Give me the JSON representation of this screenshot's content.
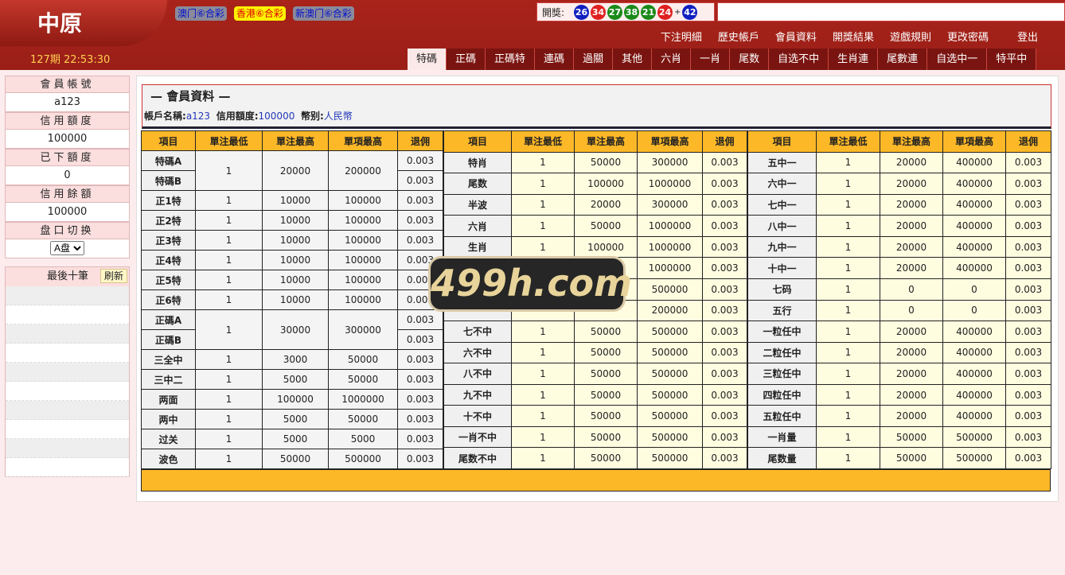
{
  "header": {
    "logo": "中原",
    "period": "127期 22:53:30",
    "lotteries": [
      {
        "label": "澳门⑥合彩",
        "active": false
      },
      {
        "label": "香港⑥合彩",
        "active": true
      },
      {
        "label": "新澳门⑥合彩",
        "active": false
      }
    ],
    "draw_label": "開獎:",
    "plus": "+",
    "balls": [
      {
        "n": "26",
        "color": "#1020c0"
      },
      {
        "n": "34",
        "color": "#e02020"
      },
      {
        "n": "27",
        "color": "#1a8a1a"
      },
      {
        "n": "38",
        "color": "#1a8a1a"
      },
      {
        "n": "21",
        "color": "#1a8a1a"
      },
      {
        "n": "24",
        "color": "#e02020"
      }
    ],
    "special": {
      "n": "42",
      "color": "#1020c0"
    },
    "nav": [
      "下注明細",
      "歷史帳戶",
      "會員資料",
      "開獎結果",
      "遊戲規則",
      "更改密碼",
      "登出"
    ],
    "tabs": [
      "特碼",
      "正碼",
      "正碼特",
      "連碼",
      "過關",
      "其他",
      "六肖",
      "一肖",
      "尾数",
      "自选不中",
      "生肖連",
      "尾數連",
      "自选中一",
      "特平中"
    ],
    "active_tab": 0
  },
  "sidebar": {
    "account_label": "會員帳號",
    "account": "a123",
    "credit_label": "信用額度",
    "credit": "100000",
    "placed_label": "已下額度",
    "placed": "0",
    "balance_label": "信用餘額",
    "balance": "100000",
    "switch_label": "盘口切换",
    "switch_value": "A盘",
    "last_label": "最後十筆",
    "refresh": "刷新"
  },
  "main": {
    "title": "— 會員資料 —",
    "acct_label": "帳戶名稱:",
    "acct": "a123",
    "credit_label": "信用額度:",
    "credit": "100000",
    "cur_label": "幣别:",
    "cur": "人民幣",
    "headers": [
      "項目",
      "單注最低",
      "單注最高",
      "單項最高",
      "退佣"
    ],
    "tables": [
      [
        [
          "特碼A",
          "1",
          "20000",
          "200000",
          "0.003",
          2
        ],
        [
          "特碼B",
          null,
          null,
          null,
          "0.003"
        ],
        [
          "正1特",
          "1",
          "10000",
          "100000",
          "0.003"
        ],
        [
          "正2特",
          "1",
          "10000",
          "100000",
          "0.003"
        ],
        [
          "正3特",
          "1",
          "10000",
          "100000",
          "0.003"
        ],
        [
          "正4特",
          "1",
          "10000",
          "100000",
          "0.003"
        ],
        [
          "正5特",
          "1",
          "10000",
          "100000",
          "0.003"
        ],
        [
          "正6特",
          "1",
          "10000",
          "100000",
          "0.003"
        ],
        [
          "正碼A",
          "1",
          "30000",
          "300000",
          "0.003",
          2
        ],
        [
          "正碼B",
          null,
          null,
          null,
          "0.003"
        ],
        [
          "三全中",
          "1",
          "3000",
          "50000",
          "0.003"
        ],
        [
          "三中二",
          "1",
          "5000",
          "50000",
          "0.003"
        ],
        [
          "两面",
          "1",
          "100000",
          "1000000",
          "0.003"
        ],
        [
          "两中",
          "1",
          "5000",
          "50000",
          "0.003"
        ],
        [
          "过关",
          "1",
          "5000",
          "5000",
          "0.003"
        ],
        [
          "波色",
          "1",
          "50000",
          "500000",
          "0.003"
        ]
      ],
      [
        [
          "特肖",
          "1",
          "50000",
          "300000",
          "0.003"
        ],
        [
          "尾数",
          "1",
          "100000",
          "1000000",
          "0.003"
        ],
        [
          "半波",
          "1",
          "20000",
          "300000",
          "0.003"
        ],
        [
          "六肖",
          "1",
          "50000",
          "1000000",
          "0.003"
        ],
        [
          "生肖",
          "1",
          "100000",
          "1000000",
          "0.003"
        ],
        [
          "",
          "",
          "",
          "1000000",
          "0.003"
        ],
        [
          "",
          "",
          "",
          "500000",
          "0.003"
        ],
        [
          "",
          "",
          "",
          "200000",
          "0.003"
        ],
        [
          "七不中",
          "1",
          "50000",
          "500000",
          "0.003"
        ],
        [
          "六不中",
          "1",
          "50000",
          "500000",
          "0.003"
        ],
        [
          "八不中",
          "1",
          "50000",
          "500000",
          "0.003"
        ],
        [
          "九不中",
          "1",
          "50000",
          "500000",
          "0.003"
        ],
        [
          "十不中",
          "1",
          "50000",
          "500000",
          "0.003"
        ],
        [
          "一肖不中",
          "1",
          "50000",
          "500000",
          "0.003"
        ],
        [
          "尾数不中",
          "1",
          "50000",
          "500000",
          "0.003"
        ]
      ],
      [
        [
          "五中一",
          "1",
          "20000",
          "400000",
          "0.003"
        ],
        [
          "六中一",
          "1",
          "20000",
          "400000",
          "0.003"
        ],
        [
          "七中一",
          "1",
          "20000",
          "400000",
          "0.003"
        ],
        [
          "八中一",
          "1",
          "20000",
          "400000",
          "0.003"
        ],
        [
          "九中一",
          "1",
          "20000",
          "400000",
          "0.003"
        ],
        [
          "十中一",
          "1",
          "20000",
          "400000",
          "0.003"
        ],
        [
          "七码",
          "1",
          "0",
          "0",
          "0.003"
        ],
        [
          "五行",
          "1",
          "0",
          "0",
          "0.003"
        ],
        [
          "一粒任中",
          "1",
          "20000",
          "400000",
          "0.003"
        ],
        [
          "二粒任中",
          "1",
          "20000",
          "400000",
          "0.003"
        ],
        [
          "三粒任中",
          "1",
          "20000",
          "400000",
          "0.003"
        ],
        [
          "四粒任中",
          "1",
          "20000",
          "400000",
          "0.003"
        ],
        [
          "五粒任中",
          "1",
          "20000",
          "400000",
          "0.003"
        ],
        [
          "一肖量",
          "1",
          "50000",
          "500000",
          "0.003"
        ],
        [
          "尾数量",
          "1",
          "50000",
          "500000",
          "0.003"
        ]
      ]
    ]
  },
  "watermark": "499h.com"
}
